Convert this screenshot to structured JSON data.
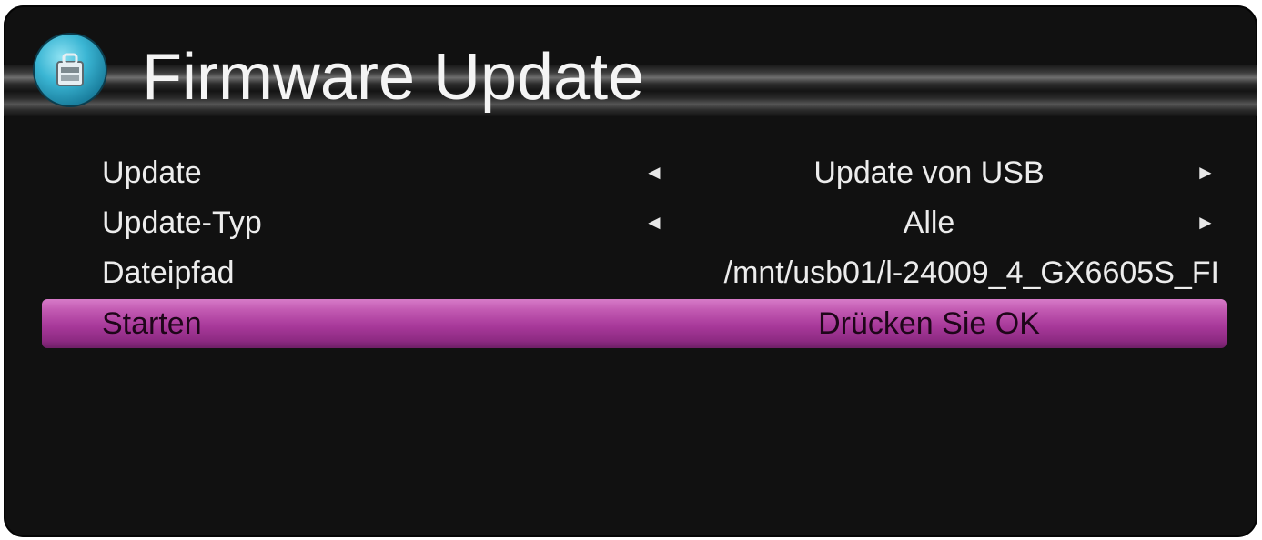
{
  "header": {
    "title": "Firmware Update",
    "icon": "firmware-update-icon"
  },
  "menu": {
    "items": [
      {
        "label": "Update",
        "value": "Update von USB",
        "has_arrows": true
      },
      {
        "label": "Update-Typ",
        "value": "Alle",
        "has_arrows": true
      },
      {
        "label": "Dateipfad",
        "value": "/mnt/usb01/l-24009_4_GX6605S_FI",
        "has_arrows": false
      },
      {
        "label": "Starten",
        "value": "Drücken Sie OK",
        "has_arrows": false,
        "selected": true
      }
    ],
    "arrow_left": "◄",
    "arrow_right": "►"
  },
  "colors": {
    "background": "#111111",
    "highlight": "#b040a0",
    "text": "#ececec",
    "icon_accent": "#3bb6d4"
  }
}
